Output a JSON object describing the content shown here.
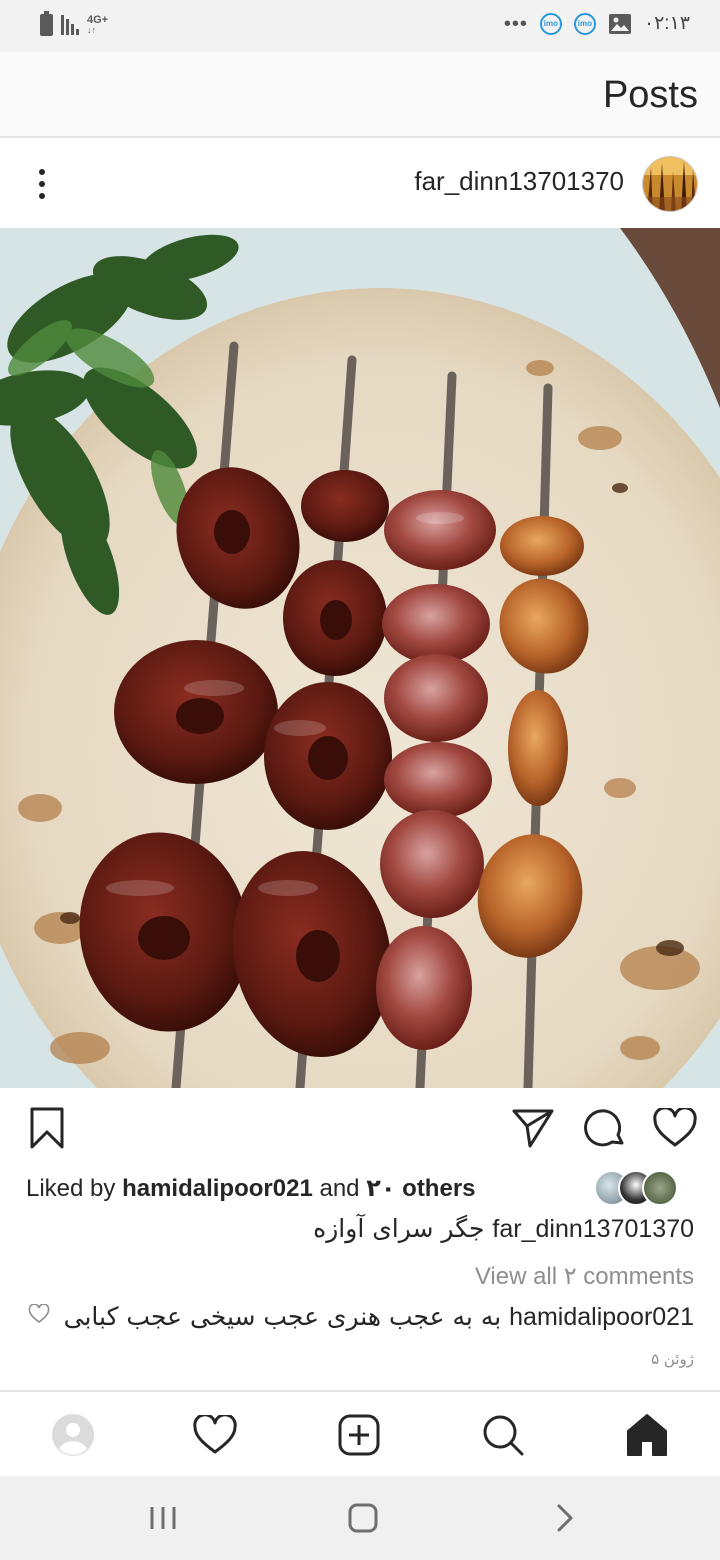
{
  "status_bar": {
    "network": "4G+",
    "time": "۰۲:۱۳",
    "overflow": "•••",
    "imo_label": "imo"
  },
  "header": {
    "title": "Posts"
  },
  "post": {
    "username": "far_dinn13701370",
    "likes": {
      "prefix": "Liked by",
      "liker": "hamidalipoor021",
      "middle": "and",
      "others": "۲۰ others"
    },
    "caption": {
      "username": "far_dinn13701370",
      "text": "جگر سرای آوازه"
    },
    "view_all_comments": "View all ۲ comments",
    "comment": {
      "username": "hamidalipoor021",
      "text": "به به عجب هنری عجب سیخی عجب کبابی"
    },
    "date": "۵ ژوئن"
  },
  "icons": {
    "more": "more-options-icon",
    "save": "bookmark-icon",
    "share": "send-icon",
    "comment": "comment-icon",
    "like": "heart-icon",
    "profile": "profile-icon",
    "activity": "heart-icon",
    "new_post": "plus-square-icon",
    "search": "search-icon",
    "home": "home-icon"
  },
  "colors": {
    "text": "#262626",
    "muted": "#8e8e8e",
    "imo": "#2a98d6"
  }
}
